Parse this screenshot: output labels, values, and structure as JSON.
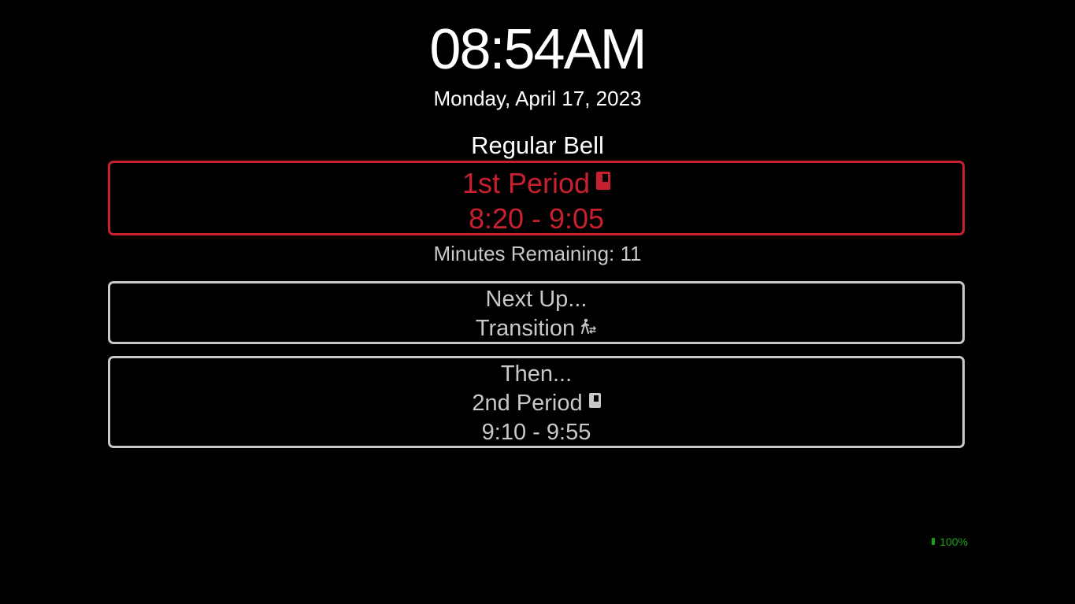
{
  "clock": {
    "time": "08:54AM",
    "date": "Monday, April 17, 2023"
  },
  "schedule": {
    "name": "Regular Bell"
  },
  "current_period": {
    "name": "1st Period",
    "times": "8:20 - 9:05",
    "icon": "book-icon",
    "color": "#c8202f"
  },
  "remaining": {
    "text": "Minutes Remaining: 11"
  },
  "next_up": {
    "heading": "Next Up...",
    "name": "Transition",
    "icon": "walking-icon"
  },
  "then": {
    "heading": "Then...",
    "name": "2nd Period",
    "times": "9:10 - 9:55",
    "icon": "book-icon"
  },
  "battery": {
    "level": "100%",
    "color": "#1aa31a"
  }
}
